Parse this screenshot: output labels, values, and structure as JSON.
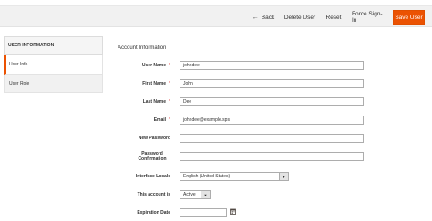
{
  "actions": {
    "back_label": "Back",
    "back_arrow": "←",
    "delete_label": "Delete User",
    "reset_label": "Reset",
    "force_signin_label": "Force Sign-In",
    "save_label": "Save User"
  },
  "sidebar": {
    "heading": "USER INFORMATION",
    "items": [
      {
        "label": "User Info"
      },
      {
        "label": "User Role"
      }
    ]
  },
  "form": {
    "section_title": "Account Information",
    "required_marker": "*",
    "fields": {
      "user_name": {
        "label": "User Name",
        "value": "johndee"
      },
      "first_name": {
        "label": "First Name",
        "value": "John"
      },
      "last_name": {
        "label": "Last Name",
        "value": "Dee"
      },
      "email": {
        "label": "Email",
        "value": "johndee@example.sps"
      },
      "new_password": {
        "label": "New Password",
        "value": ""
      },
      "password_confirmation": {
        "label": "Password Confirmation",
        "value": ""
      },
      "interface_locale": {
        "label": "Interface Locale",
        "value": "English (United States)"
      },
      "account_status": {
        "label": "This account is",
        "value": "Active"
      },
      "expiration_date": {
        "label": "Expiration Date",
        "value": ""
      }
    }
  },
  "colors": {
    "accent": "#eb5202",
    "required": "#e22626"
  }
}
